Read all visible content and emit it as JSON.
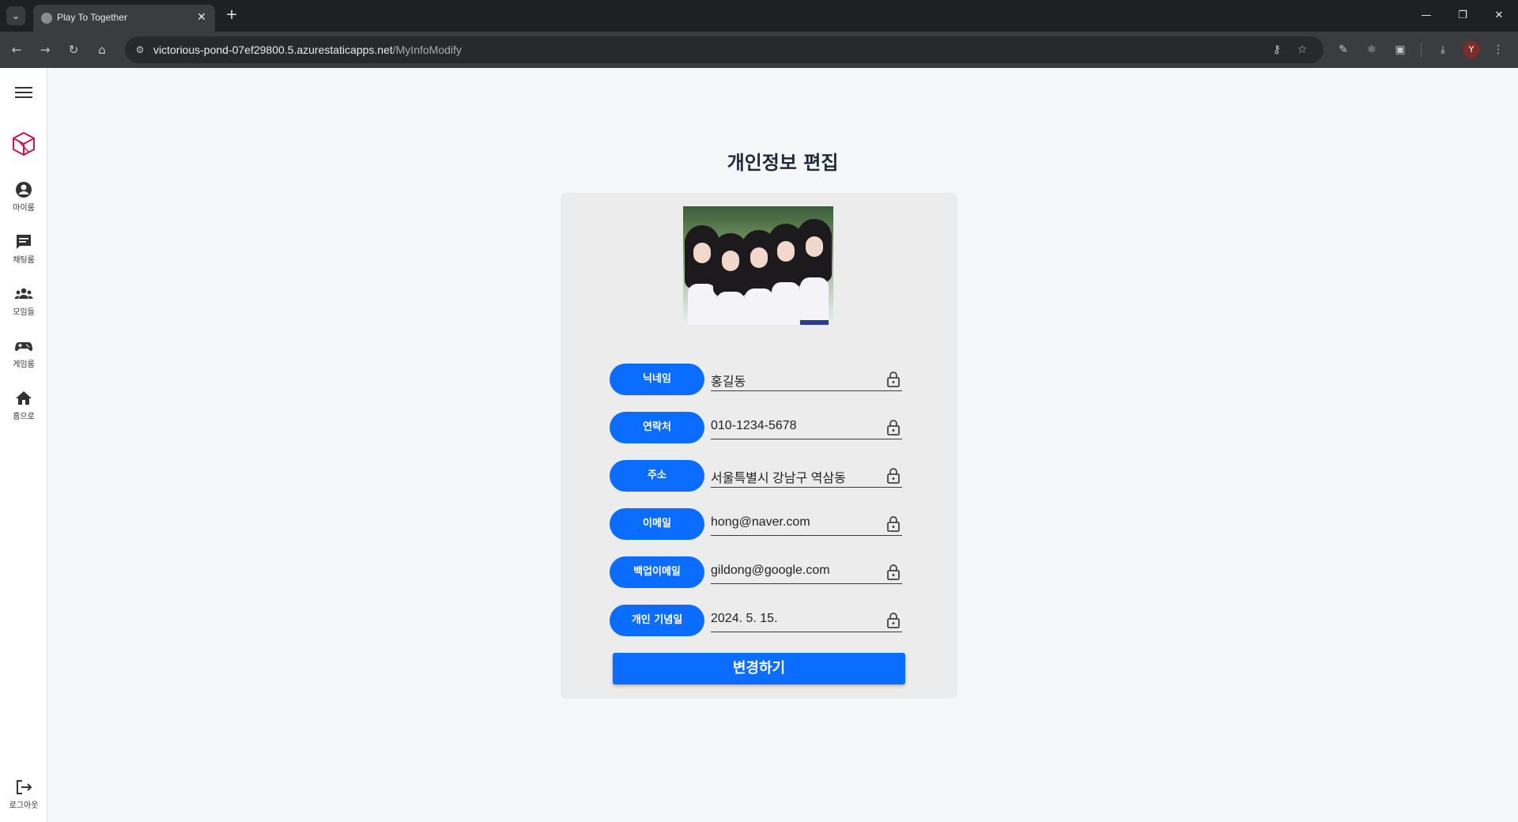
{
  "browser": {
    "tab_title": "Play To Together",
    "url_host": "victorious-pond-07ef29800.5.azurestaticapps.net",
    "url_path": "/MyInfoModify",
    "profile_initial": "Y"
  },
  "sidebar": {
    "items": [
      {
        "label": "마이룸",
        "icon": "person-icon"
      },
      {
        "label": "채팅룸",
        "icon": "chat-icon"
      },
      {
        "label": "모임들",
        "icon": "group-icon"
      },
      {
        "label": "게임룸",
        "icon": "gamepad-icon"
      },
      {
        "label": "홈으로",
        "icon": "home-icon"
      }
    ],
    "logout_label": "로그아웃"
  },
  "page": {
    "title": "개인정보 편집",
    "fields": [
      {
        "label": "닉네임",
        "value": "홍길동"
      },
      {
        "label": "연락처",
        "value": "010-1234-5678"
      },
      {
        "label": "주소",
        "value": "서울특별시 강남구 역삼동"
      },
      {
        "label": "이메일",
        "value": "hong@naver.com"
      },
      {
        "label": "백업이메일",
        "value": "gildong@google.com"
      },
      {
        "label": "개인 기념일",
        "value": "2024. 5. 15."
      }
    ],
    "submit_label": "변경하기"
  },
  "colors": {
    "accent": "#0a6dff",
    "card_bg": "#ececec",
    "page_bg": "#f5f6f8",
    "logo": "#c2185b"
  }
}
